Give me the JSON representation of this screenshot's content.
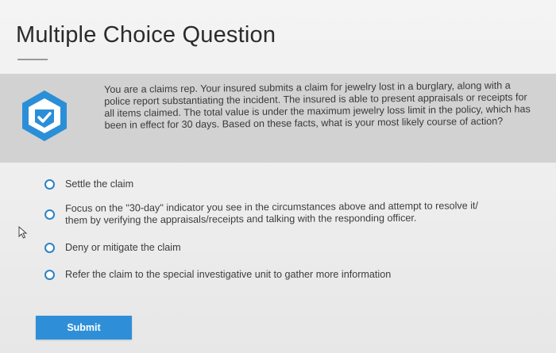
{
  "page": {
    "title": "Multiple Choice Question"
  },
  "question": {
    "icon": "shield-check-icon",
    "text": "You are a claims rep. Your insured submits a claim for jewelry lost in a burglary, along with a police report substantiating the incident. The insured is able to present appraisals or receipts for all items claimed. The total value is under the maximum jewelry loss limit in the policy, which has been in effect for 30 days. Based on these facts, what is your most likely course of action?"
  },
  "options": [
    {
      "label": "Settle the claim"
    },
    {
      "label": "Focus on the \"30-day\" indicator you see in the circumstances above and attempt to resolve it/ them by verifying the appraisals/receipts and talking with the responding officer."
    },
    {
      "label": "Deny or mitigate the claim"
    },
    {
      "label": "Refer the claim to the special investigative unit to gather more information"
    }
  ],
  "actions": {
    "submit_label": "Submit"
  },
  "colors": {
    "accent": "#2e8fd8",
    "badge": "#2b8fd8",
    "band": "#d2d2d2"
  }
}
